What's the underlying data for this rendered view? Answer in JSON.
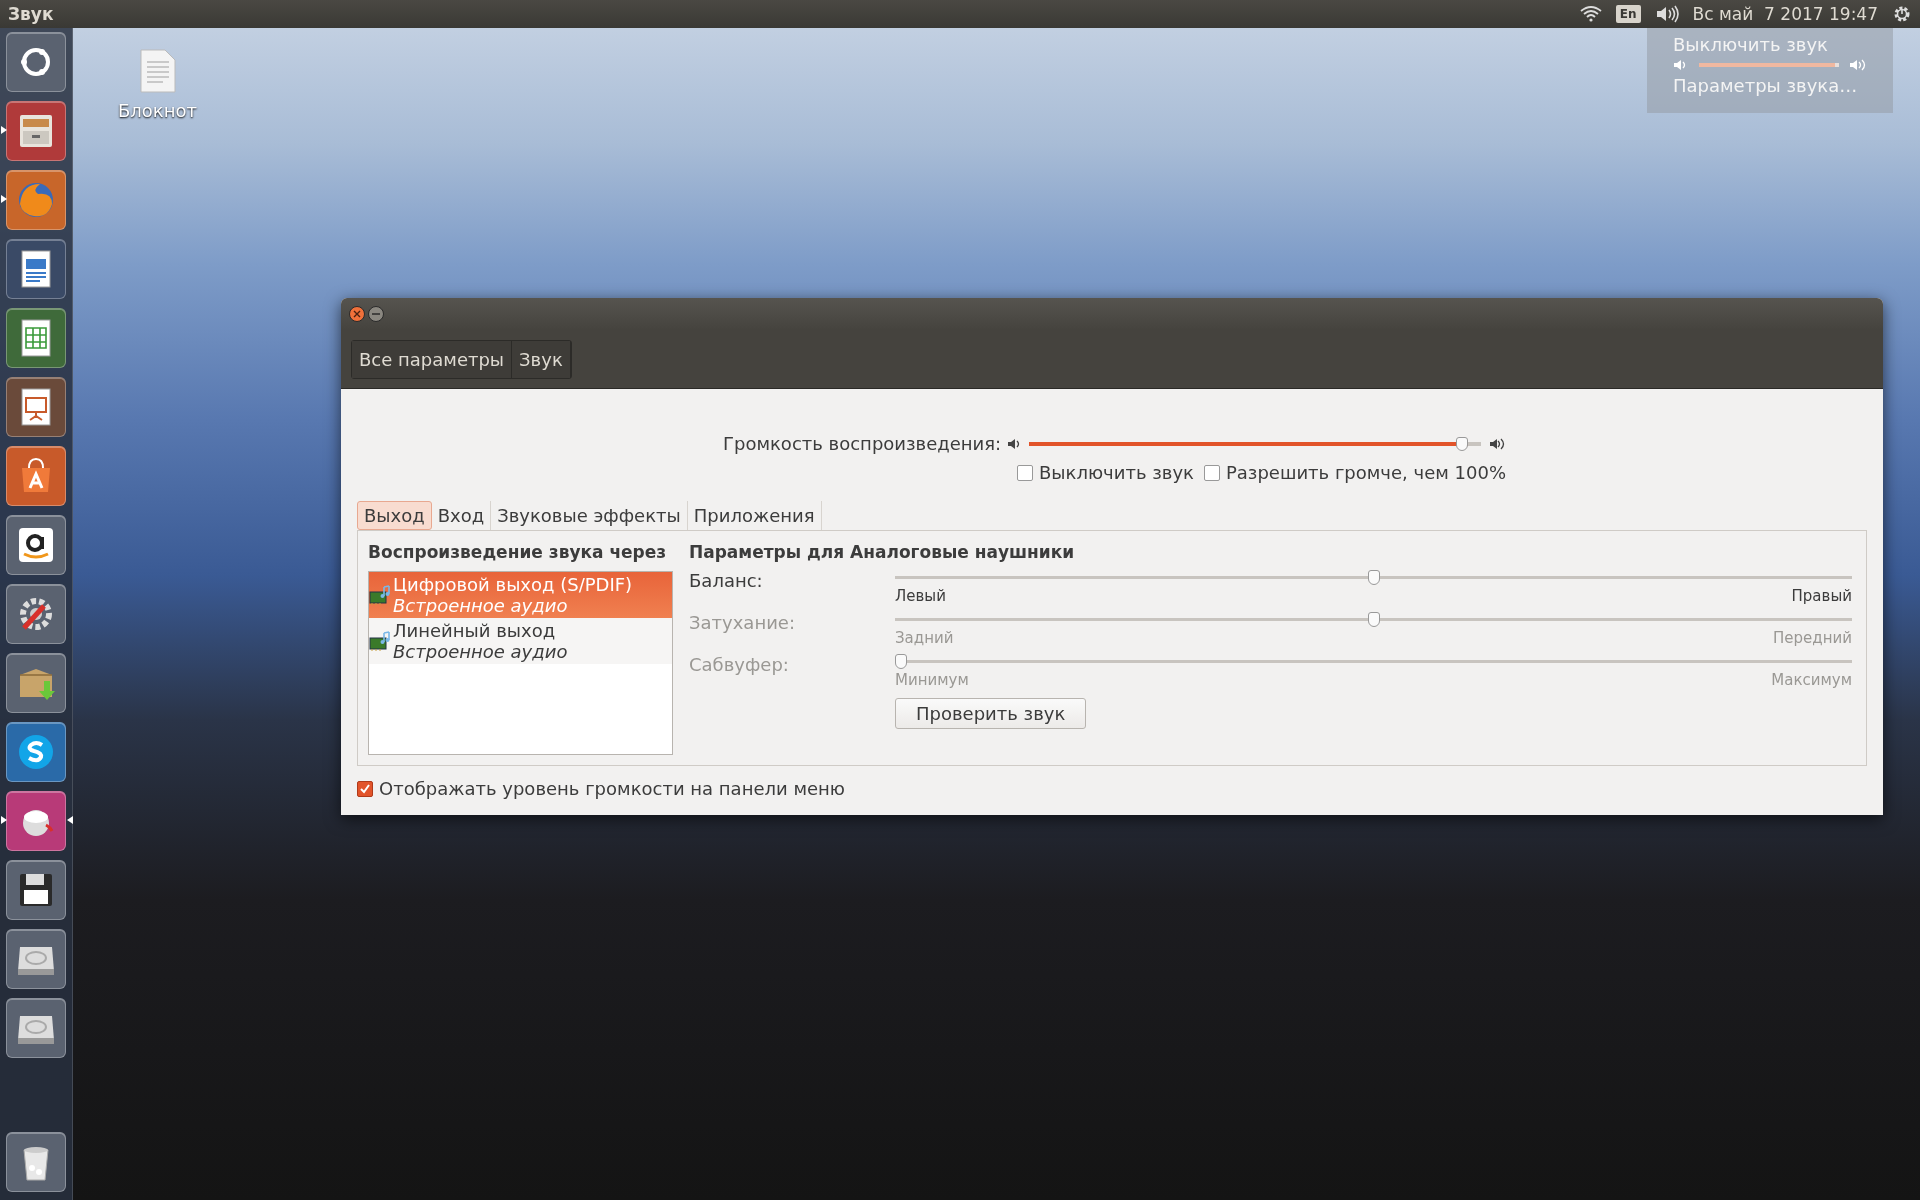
{
  "top_panel": {
    "app_title": "Звук",
    "keyboard_layout": "En",
    "clock": "Вс май  7 2017 19:47"
  },
  "sound_menu": {
    "mute_item": "Выключить звук",
    "level": 0.97,
    "settings_item": "Параметры звука…"
  },
  "launcher": [
    {
      "kind": "dash",
      "running": false,
      "focused": false
    },
    {
      "kind": "files",
      "running": true,
      "focused": false
    },
    {
      "kind": "browser",
      "running": true,
      "focused": false
    },
    {
      "kind": "writer",
      "running": false,
      "focused": false
    },
    {
      "kind": "calc",
      "running": false,
      "focused": false
    },
    {
      "kind": "impress",
      "running": false,
      "focused": false
    },
    {
      "kind": "software",
      "running": false,
      "focused": false
    },
    {
      "kind": "amazon",
      "running": false,
      "focused": false
    },
    {
      "kind": "settings",
      "running": false,
      "focused": false
    },
    {
      "kind": "archive",
      "running": false,
      "focused": false
    },
    {
      "kind": "skype",
      "running": false,
      "focused": false
    },
    {
      "kind": "tweak",
      "running": true,
      "focused": true
    },
    {
      "kind": "floppy",
      "running": false,
      "focused": false
    },
    {
      "kind": "drive",
      "running": false,
      "focused": false
    },
    {
      "kind": "drive",
      "running": false,
      "focused": false
    },
    {
      "kind": "trash",
      "running": false,
      "focused": false
    }
  ],
  "desktop_icons": [
    {
      "label": "Блокнот"
    }
  ],
  "window": {
    "breadcrumbs": [
      "Все параметры",
      "Звук"
    ],
    "output_volume": {
      "label": "Громкость воспроизведения:",
      "level": 0.97
    },
    "options": [
      {
        "label": "Выключить звук",
        "checked": false
      },
      {
        "label": "Разрешить громче, чем 100%",
        "checked": false
      }
    ],
    "tabs": [
      {
        "label": "Выход",
        "selected": true
      },
      {
        "label": "Вход",
        "selected": false
      },
      {
        "label": "Звуковые эффекты",
        "selected": false
      },
      {
        "label": "Приложения",
        "selected": false
      }
    ],
    "device_list": {
      "heading": "Воспроизведение звука через",
      "items": [
        {
          "name": "Цифровой выход (S/PDIF)",
          "description": "Встроенное аудио",
          "selected": true
        },
        {
          "name": "Линейный выход",
          "description": "Встроенное аудио",
          "selected": false
        }
      ]
    },
    "settings": {
      "heading": "Параметры для Аналоговые наушники",
      "sliders": [
        {
          "label": "Баланс:",
          "level": 0.5,
          "disabled": false,
          "min_label": "Левый",
          "max_label": "Правый"
        },
        {
          "label": "Затухание:",
          "level": 0.5,
          "disabled": true,
          "min_label": "Задний",
          "max_label": "Передний"
        },
        {
          "label": "Сабвуфер:",
          "level": 0.0,
          "disabled": true,
          "min_label": "Минимум",
          "max_label": "Максимум"
        }
      ],
      "test_button": "Проверить звук"
    },
    "show_in_panel": {
      "label": "Отображать уровень громкости на панели меню",
      "checked": true
    }
  }
}
